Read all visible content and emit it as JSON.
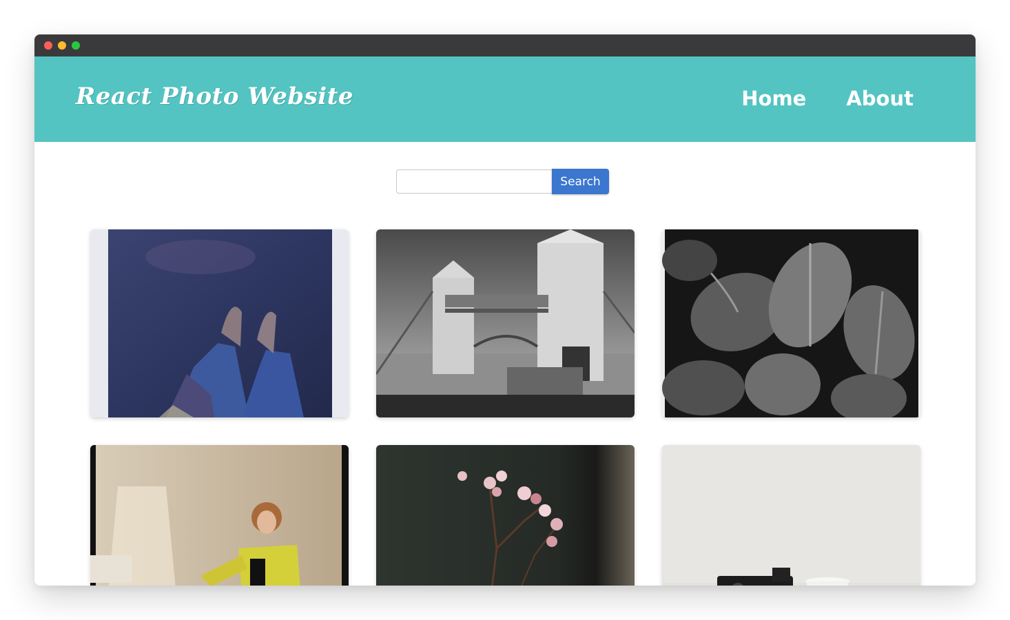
{
  "window": {
    "controls": [
      "close",
      "minimize",
      "maximize"
    ],
    "colors": {
      "close": "#ff5f57",
      "minimize": "#febc2e",
      "maximize": "#28c840"
    }
  },
  "navbar": {
    "brand": "React Photo Website",
    "background": "#53c4c2",
    "links": [
      {
        "label": "Home"
      },
      {
        "label": "About"
      }
    ]
  },
  "search": {
    "value": "",
    "placeholder": "",
    "button_label": "Search",
    "button_color": "#3b76cf"
  },
  "gallery": {
    "photos": [
      {
        "subject": "polaroid-feet-on-ground"
      },
      {
        "subject": "tower-bridge-black-white"
      },
      {
        "subject": "monstera-leaves-black-white"
      },
      {
        "subject": "woman-yellow-jacket-seated"
      },
      {
        "subject": "pink-flowers-dark-background"
      },
      {
        "subject": "camera-on-white-surface"
      }
    ]
  }
}
